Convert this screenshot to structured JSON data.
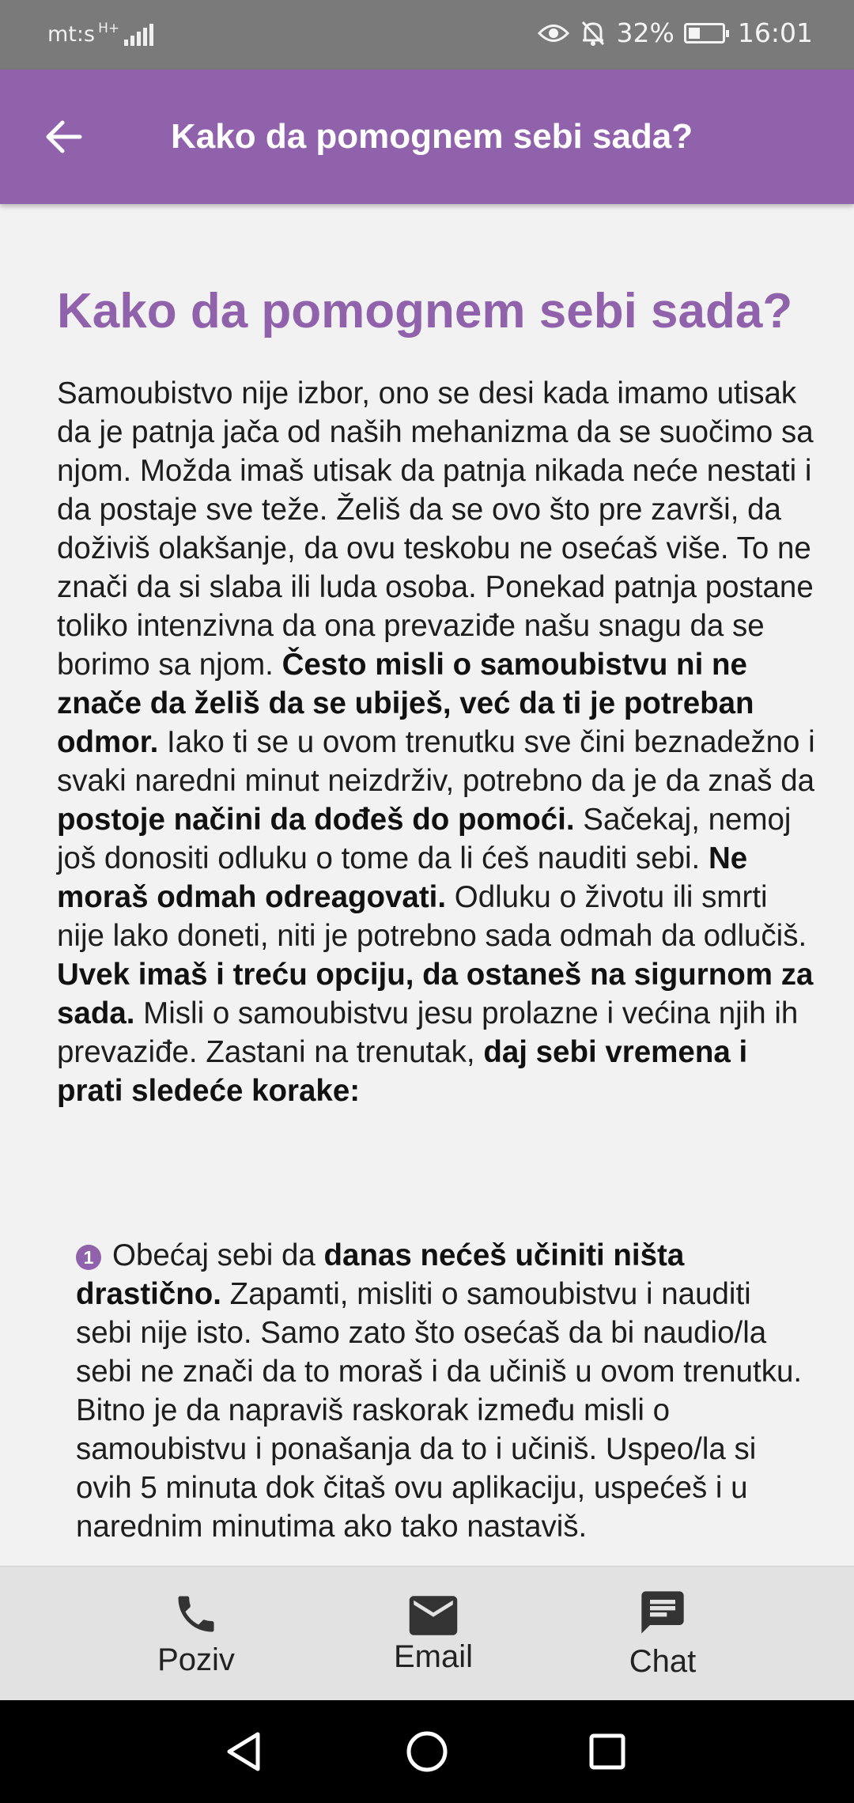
{
  "status_bar": {
    "carrier": "mt:s",
    "network": "H+",
    "battery": "32%",
    "time": "16:01",
    "icons": [
      "eye-icon",
      "bell-off-icon",
      "battery-saver-icon"
    ]
  },
  "app_bar": {
    "title": "Kako da pomognem sebi sada?",
    "back_icon": "arrow-left-icon"
  },
  "article": {
    "heading": "Kako da pomognem sebi sada?",
    "intro": [
      {
        "t": "Samoubistvo nije izbor, ono se desi kada imamo utisak da je patnja jača od naših mehanizma da se suočimo sa njom. Možda imaš utisak da patnja nikada neće nestati i da postaje sve teže. Želiš da se ovo što pre završi, da doživiš olakšanje, da ovu teskobu ne osećaš više. To ne znači da si slaba ili luda osoba. Ponekad patnja postane toliko intenzivna da ona prevaziđe našu snagu da se borimo sa njom.  "
      },
      {
        "b": "Često misli o samoubistvu ni ne znače da želiš da se ubiješ, već da ti je potreban odmor."
      },
      {
        "t": " Iako ti se u ovom trenutku sve čini beznadežno i svaki naredni minut neizdrživ, potrebno da je da znaš da "
      },
      {
        "b": "postoje načini da dođeš do pomoći."
      },
      {
        "t": " Sačekaj, nemoj još donositi odluku o tome da li ćeš nauditi sebi. "
      },
      {
        "b": "Ne moraš odmah odreagovati."
      },
      {
        "t": " Odluku o životu ili smrti nije lako doneti, niti je potrebno sada odmah da odlučiš. "
      },
      {
        "b": "Uvek imaš i treću opciju, da ostaneš na sigurnom za sada."
      },
      {
        "t": " Misli o samoubistvu jesu prolazne i većina njih ih prevaziđe. Zastani na trenutak, "
      },
      {
        "b": "daj sebi vremena i prati sledeće korake:"
      }
    ],
    "step1": {
      "number": "1",
      "parts": [
        {
          "t": "Obećaj sebi da "
        },
        {
          "b": "danas nećeš učiniti ništa drastično."
        },
        {
          "t": " Zapamti, misliti o samoubistvu i nauditi sebi nije isto. Samo zato što osećaš da bi naudio/la sebi ne znači da to moraš i da učiniš u ovom trenutku. Bitno je da napraviš raskorak između misli o samoubistvu i ponašanja da to i učiniš. Uspeo/la si ovih 5 minuta dok čitaš ovu aplikaciju, uspećeš i u narednim minutima ako tako nastaviš."
        }
      ]
    }
  },
  "bottom_nav": {
    "call_label": "Poziv",
    "email_label": "Email",
    "chat_label": "Chat"
  },
  "colors": {
    "accent": "#8f62ab",
    "status_bar": "#7a7a7a",
    "bottom_nav": "#e2e2e2"
  }
}
